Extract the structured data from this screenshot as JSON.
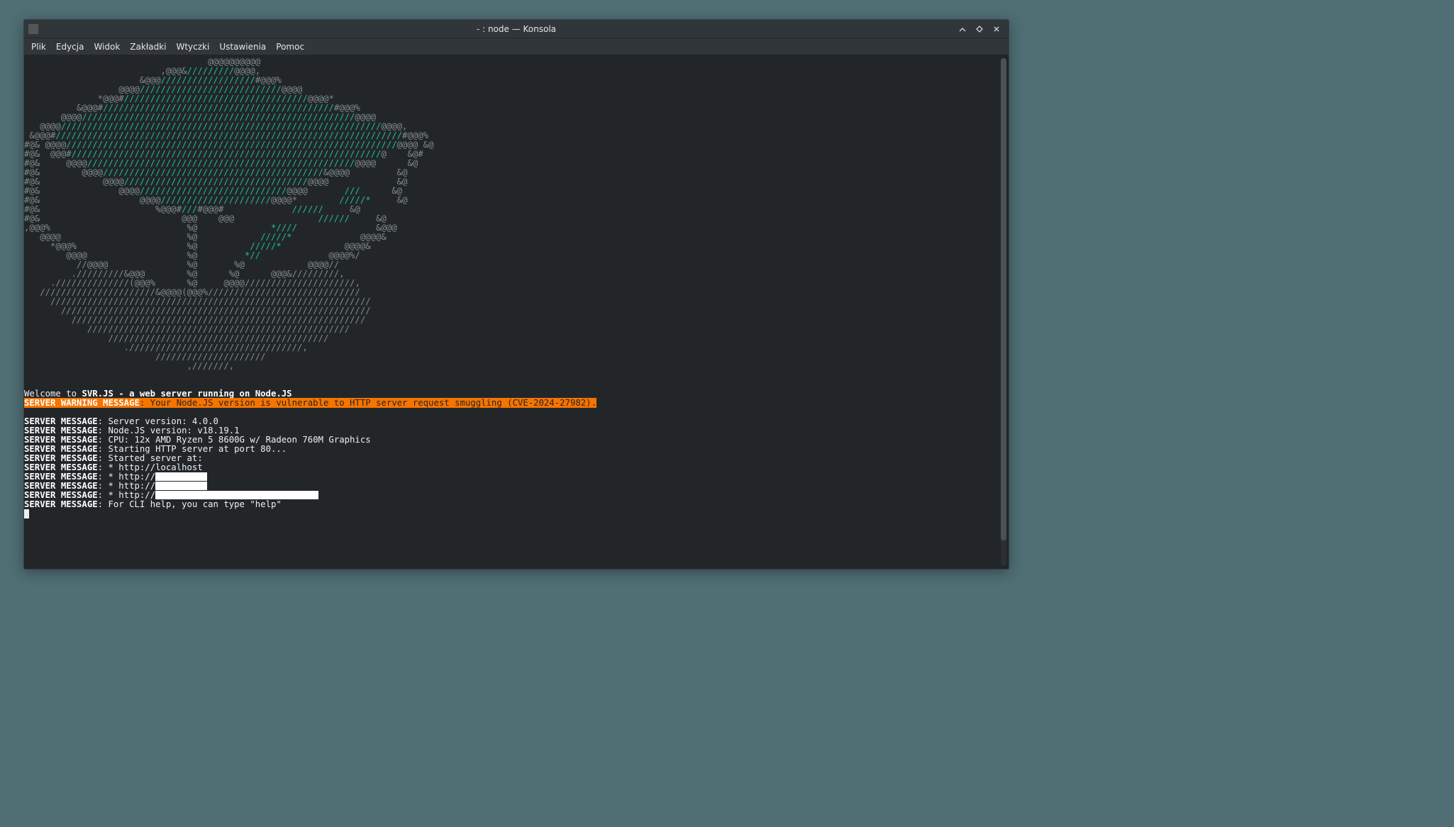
{
  "window": {
    "title": "- : node — Konsola"
  },
  "menu": {
    "plik": "Plik",
    "edycja": "Edycja",
    "widok": "Widok",
    "zakladki": "Zakładki",
    "wtyczki": "Wtyczki",
    "ustawienia": "Ustawienia",
    "pomoc": "Pomoc"
  },
  "ascii": {
    "l01": "                                   @@@@@@@@@@",
    "l02": "                          ,@@@&",
    "l02b": "/////////",
    "l02c": "@@@@,",
    "l03": "                      &@@@",
    "l03b": "//////////////////",
    "l03c": "#@@@%",
    "l04": "                  @@@@",
    "l04b": "///////////////////////////",
    "l04c": "@@@@",
    "l05": "              *@@@#",
    "l05b": "///////////////////////////////////",
    "l05c": "@@@@*",
    "l06": "          &@@@#",
    "l06b": "////////////////////////////////////////////",
    "l06c": "#@@@%",
    "l07": "       @@@@",
    "l07b": "////////////////////////////////////////////////////",
    "l07c": "@@@@",
    "l08": "   @@@@",
    "l08b": "/////////////////////////////////////////////////////////////",
    "l08c": "@@@@,",
    "l09": " &@@@#",
    "l09b": "//////////////////////////////////////////////////////////////////",
    "l09c": "#@@@%",
    "l10": "#@& @@@@",
    "l10b": "///////////////////////////////////////////////////////////////",
    "l10c": "@@@@ &@",
    "l11": "#@&  @@@#",
    "l11b": "///////////////////////////////////////////////////////////",
    "l11c": "@    &@#",
    "l12": "#@&     @@@@",
    "l12b": "///////////////////////////////////////////////////",
    "l12c": "@@@@      &@",
    "l13": "#@&        @@@@",
    "l13b": "//////////////////////////////////////////",
    "l13c": "&@@@@         &@",
    "l14": "#@&            @@@@",
    "l14b": "///////////////////////////////////",
    "l14c": "@@@@             &@",
    "l15": "#@&               @@@@",
    "l15b": "////////////////////////////",
    "l15c": "@@@@",
    "l15d": "       ///",
    "l15e": "      &@",
    "l16": "#@&                   @@@@",
    "l16b": "/////////////////////",
    "l16c": "@@@@*",
    "l16d": "        /////*",
    "l16e": "     &@",
    "l17": "#@&                      %@@@#",
    "l17b": "///",
    "l17c": "#@@@#",
    "l17d": "             //////",
    "l17e": "     &@",
    "l18": "#@&                           @@@    @@@",
    "l18b": "                //////",
    "l18c": "     &@",
    "l19": ",@@@%                          %@",
    "l19b": "              *////",
    "l19c": "               &@@@",
    "l20": "   @@@@                        %@",
    "l20b": "            /////*",
    "l20c": "             @@@@&",
    "l21": "     *@@@%                     %@",
    "l21b": "          /////*",
    "l21c": "            @@@@&",
    "l22": "        @@@@                   %@",
    "l22b": "         *//",
    "l22c": "             @@@@%/",
    "l23": "          //@@@@               %@       %@            @@@@//",
    "l24": "         ./////////&@@@        %@      %@      @@@&/////////,",
    "l25": "     .//////////////(@@@%      %@     @@@@/////////////////////,",
    "l26": "   //////////////////////&@@@@(@@@%/////////////////////////////",
    "l27": "     /////////////////////////////////////////////////////////////",
    "l28": "       ///////////////////////////////////////////////////////////",
    "l29": "         ////////////////////////////////////////////////////////",
    "l30": "            //////////////////////////////////////////////////",
    "l31": "                //////////////////////////////////////////",
    "l32": "                   ./////////////////////////////////,",
    "l33": "                         /////////////////////",
    "l34": "                               ,///////,"
  },
  "out": {
    "welcome_pre": "Welcome to ",
    "welcome_bold": "SVR.JS - a web server running on Node.JS",
    "warn_label": "SERVER WARNING MESSAGE",
    "warn_text": ": Your Node.JS version is vulnerable to HTTP server request smuggling (CVE-2024-27982).",
    "msg_label": "SERVER MESSAGE",
    "m1": ": Server version: 4.0.0",
    "m2": ": Node.JS version: v18.19.1",
    "m3": ": CPU: 12x AMD Ryzen 5 8600G w/ Radeon 760M Graphics",
    "m4": ": Starting HTTP server at port 80...",
    "m5": ": Started server at:",
    "m6": ": * http://localhost",
    "m7": ": * http://",
    "m8": ": * http://",
    "m9": ": * http://",
    "m10": ": For CLI help, you can type \"help\""
  }
}
